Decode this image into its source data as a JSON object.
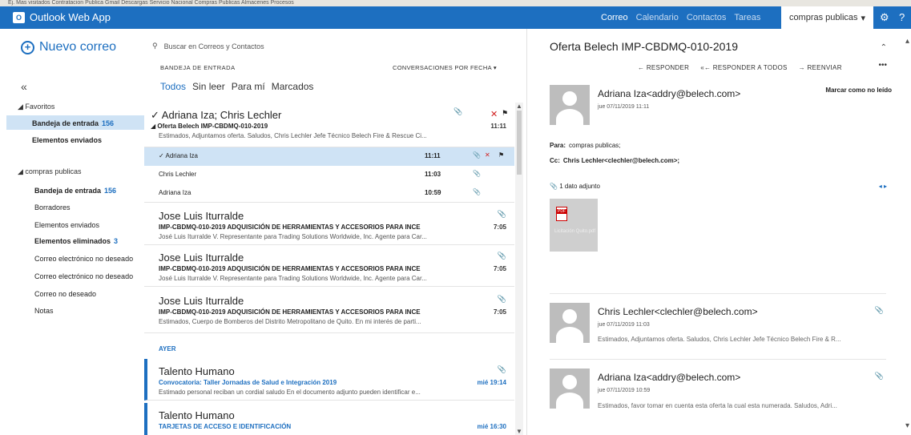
{
  "bookmarks": "Ej. Mas visitados   Contratacion Publica   Gmail   Descargas   Servicio Nacional   Compras Publicas   Almacenes   Procesos",
  "app": {
    "title": "Outlook Web App",
    "logo_letters": "O"
  },
  "topnav": {
    "items": [
      "Correo",
      "Calendario",
      "Contactos",
      "Tareas"
    ]
  },
  "account": {
    "label": "compras publicas",
    "settings_icon": "gear-icon",
    "help_icon": "?"
  },
  "leftnav": {
    "new_mail": "Nuevo correo",
    "collapse": "«",
    "favorites_label": "Favoritos",
    "favorites": [
      {
        "label": "Bandeja de entrada",
        "count": "156"
      },
      {
        "label": "Elementos enviados",
        "count": ""
      }
    ],
    "mailbox_label": "compras publicas",
    "folders": [
      {
        "label": "Bandeja de entrada",
        "count": "156"
      },
      {
        "label": "Borradores",
        "count": ""
      },
      {
        "label": "Elementos enviados",
        "count": ""
      },
      {
        "label": "Elementos eliminados",
        "count": "3"
      },
      {
        "label": "Correo electrónico no deseado",
        "count": ""
      },
      {
        "label": "Correo electrónico no deseado",
        "count": ""
      },
      {
        "label": "Correo no deseado",
        "count": ""
      },
      {
        "label": "Notas",
        "count": ""
      }
    ]
  },
  "list": {
    "search_placeholder": "Buscar en Correos y Contactos",
    "folder_title": "BANDEJA DE ENTRADA",
    "sort": "CONVERSACIONES POR FECHA",
    "filters": [
      "Todos",
      "Sin leer",
      "Para mí",
      "Marcados"
    ],
    "thread": {
      "from": "Adriana Iza; Chris Lechler",
      "subject": "Oferta Belech IMP-CBDMQ-010-2019",
      "time": "11:11",
      "preview": "Estimados, Adjuntamos oferta. Saludos, Chris Lechler Jefe Técnico Belech Fire & Rescue Ci...",
      "rows": [
        {
          "name": "Adriana Iza",
          "time": "11:11"
        },
        {
          "name": "Chris Lechler",
          "time": "11:03"
        },
        {
          "name": "Adriana Iza",
          "time": "10:59"
        }
      ]
    },
    "messages": [
      {
        "from": "Jose Luis Iturralde",
        "subject": "IMP-CBDMQ-010-2019 ADQUISICIÓN DE HERRAMIENTAS Y ACCESORIOS PARA INCE",
        "time": "7:05",
        "preview": "José Luis Iturralde V. Representante para Trading Solutions Worldwide, Inc. Agente para Car..."
      },
      {
        "from": "Jose Luis Iturralde",
        "subject": "IMP-CBDMQ-010-2019 ADQUISICIÓN DE HERRAMIENTAS Y ACCESORIOS PARA INCE",
        "time": "7:05",
        "preview": "José Luis Iturralde V. Representante para Trading Solutions Worldwide, Inc. Agente para Car..."
      },
      {
        "from": "Jose Luis Iturralde",
        "subject": "IMP-CBDMQ-010-2019 ADQUISICIÓN DE HERRAMIENTAS Y ACCESORIOS PARA INCE",
        "time": "7:05",
        "preview": "Estimados, Cuerpo de Bomberos del Distrito Metropolitano de Quito. En mi interés de parti..."
      }
    ],
    "group_label": "AYER",
    "yesterday": [
      {
        "from": "Talento Humano",
        "subject": "Convocatoria: Taller Jornadas de Salud e Integración 2019",
        "time": "mié 19:14",
        "preview": "Estimado personal reciban un cordial saludo En el documento adjunto pueden identificar e..."
      },
      {
        "from": "Talento Humano",
        "subject": "TARJETAS DE ACCESO E IDENTIFICACIÓN",
        "time": "mié 16:30",
        "preview": ""
      }
    ]
  },
  "reading": {
    "subject": "Oferta Belech IMP-CBDMQ-010-2019",
    "actions": [
      "RESPONDER",
      "RESPONDER A TODOS",
      "REENVIAR"
    ],
    "mark_unread": "Marcar como no leído",
    "current": {
      "sender": "Adriana Iza<addry@belech.com>",
      "date": "jue 07/11/2019 11:11",
      "to_label": "Para:",
      "to": "compras publicas;",
      "cc_label": "Cc:",
      "cc": "Chris Lechler<clechler@belech.com>;",
      "attachments_label": "1 dato adjunto",
      "attachment_name": "Licitación Quito.pdf"
    },
    "others": [
      {
        "sender": "Chris Lechler<clechler@belech.com>",
        "date": "jue 07/11/2019 11:03",
        "preview": "Estimados, Adjuntamos oferta. Saludos, Chris Lechler Jefe Técnico Belech Fire & R..."
      },
      {
        "sender": "Adriana Iza<addry@belech.com>",
        "date": "jue 07/11/2019 10:59",
        "preview": "Estimados, favor tomar en cuenta esta oferta la cual esta numerada. Saludos, Adri..."
      }
    ]
  }
}
